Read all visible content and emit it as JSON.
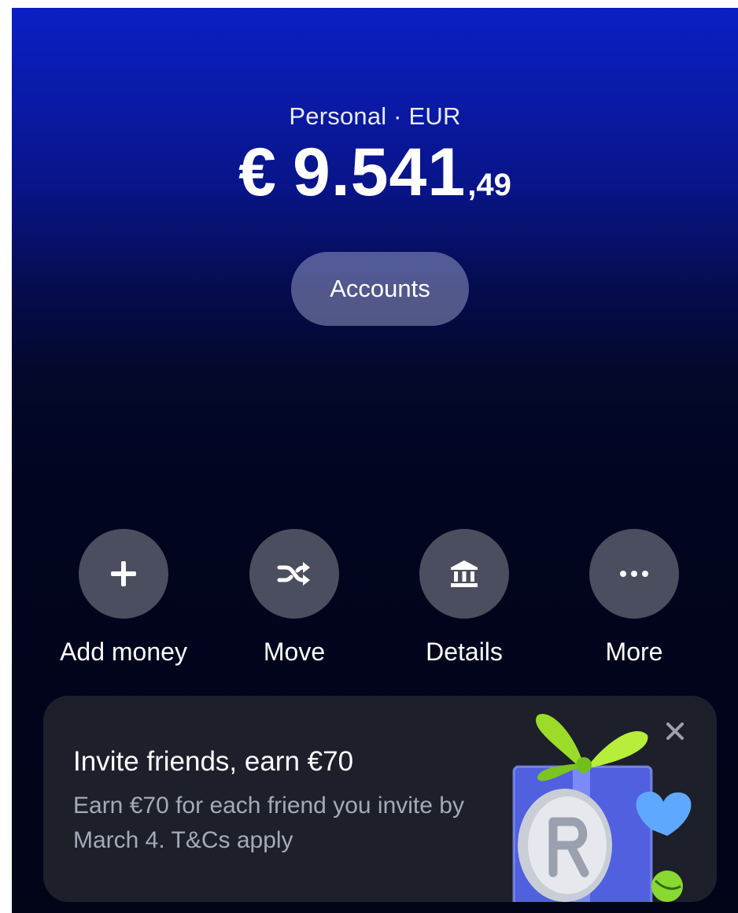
{
  "header": {
    "account_label": "Personal · EUR",
    "balance": {
      "currency": "€",
      "integer": "9.541",
      "decimals": ",49"
    },
    "accounts_button": "Accounts"
  },
  "actions": [
    {
      "label": "Add money",
      "icon": "plus-icon"
    },
    {
      "label": "Move",
      "icon": "shuffle-icon"
    },
    {
      "label": "Details",
      "icon": "bank-icon"
    },
    {
      "label": "More",
      "icon": "ellipsis-icon"
    }
  ],
  "promo": {
    "title": "Invite friends, earn €70",
    "text": "Earn €70 for each friend you invite by March 4. T&Cs apply",
    "close_icon": "close-icon",
    "image": "gift-coin-illustration"
  },
  "colors": {
    "gradient_top": "#0b1fc4",
    "gradient_bottom": "#020418",
    "action_circle": "#4a4e5e",
    "promo_card": "#1d1f2b",
    "promo_text": "#a6a9b8"
  }
}
